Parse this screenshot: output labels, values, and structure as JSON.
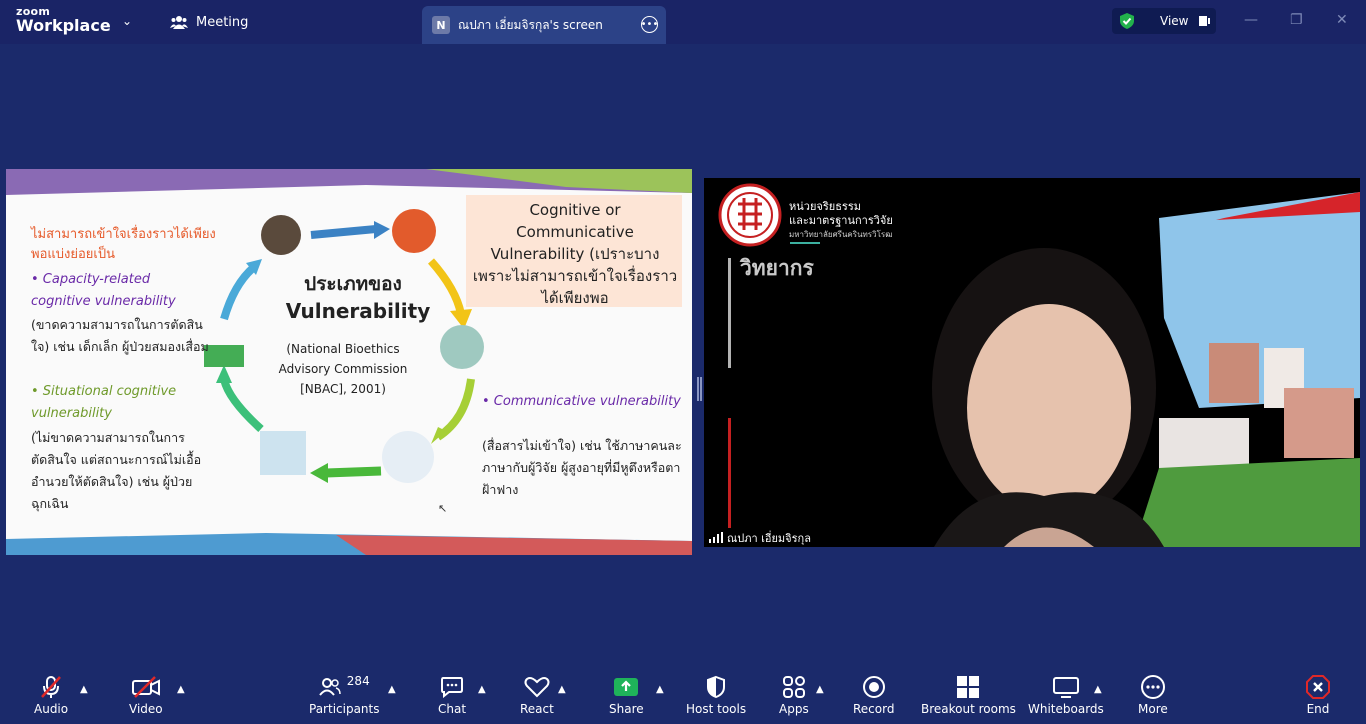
{
  "app": {
    "logo_line1": "zoom",
    "logo_line2": "Workplace",
    "meeting_label": "Meeting",
    "tab_initial": "N",
    "tab_title": "ณปภา เอี่ยมจิรกุล's screen",
    "view_label": "View"
  },
  "slide": {
    "left_heading": "ไม่สามารถเข้าใจเรื่องราวได้เพียงพอแบ่งย่อยเป็น",
    "bullet1_title": "• Capacity-related cognitive vulnerability",
    "bullet1_body": "(ขาดความสามารถในการตัดสินใจ) เช่น เด็กเล็ก ผู้ป่วยสมองเสื่อม",
    "bullet2_title": "• Situational cognitive vulnerability",
    "bullet2_body": "(ไม่ขาดความสามารถในการตัดสินใจ แต่สถานะการณ์ไม่เอื้ออำนวยให้ตัดสินใจ) เช่น ผู้ป่วยฉุกเฉิน",
    "center_title_th": "ประเภทของ",
    "center_title_en": "Vulnerability",
    "center_source": "(National Bioethics Advisory Commission [NBAC], 2001)",
    "right_box": "Cognitive or Communicative Vulnerability (เปราะบางเพราะไม่สามารถเข้าใจเรื่องราวได้เพียงพอ",
    "bullet3_title": "• Communicative vulnerability",
    "bullet3_body": "(สื่อสารไม่เข้าใจ) เช่น ใช้ภาษาคนละภาษากับผู้วิจัย ผู้สูงอายุที่มีหูตึงหรือตาฝ้าฟาง"
  },
  "video": {
    "org_line1": "หน่วยจริยธรรม",
    "org_line2": "และมาตรฐานการวิจัย",
    "org_line3": "มหาวิทยาลัยศรีนครินทรวิโรฒ",
    "speaker_label": "วิทยากร",
    "participant_name": "ณปภา เอี่ยมจิรกุล"
  },
  "toolbar": {
    "audio": "Audio",
    "video": "Video",
    "participants": "Participants",
    "participants_count": "284",
    "chat": "Chat",
    "react": "React",
    "share": "Share",
    "host_tools": "Host tools",
    "apps": "Apps",
    "record": "Record",
    "breakout": "Breakout rooms",
    "whiteboards": "Whiteboards",
    "more": "More",
    "end": "End"
  },
  "colors": {
    "background": "#1b2a6b",
    "share_green": "#1fb35a",
    "end_red": "#e02828",
    "shield_green": "#22b24c"
  }
}
